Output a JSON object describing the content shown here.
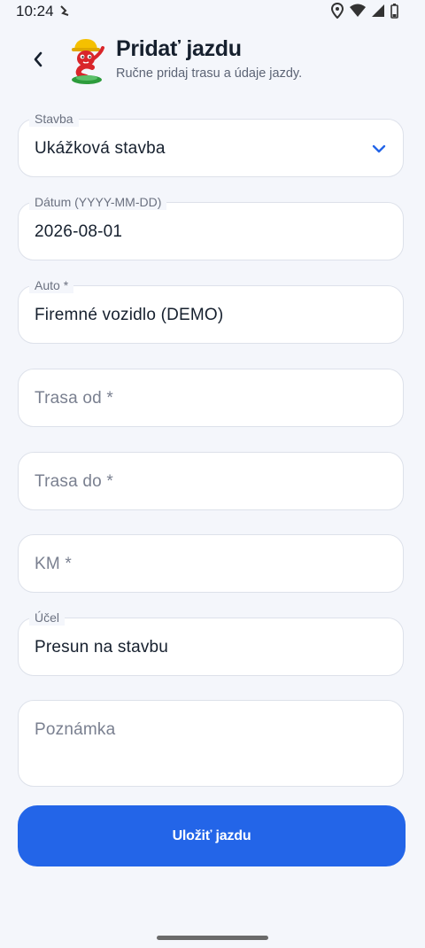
{
  "status_bar": {
    "time": "10:24"
  },
  "header": {
    "title": "Pridať jazdu",
    "subtitle": "Ručne pridaj trasu a údaje jazdy."
  },
  "form": {
    "stavba": {
      "label": "Stavba",
      "value": "Ukážková stavba"
    },
    "datum": {
      "label": "Dátum (YYYY-MM-DD)",
      "value": "2026-08-01"
    },
    "auto": {
      "label": "Auto *",
      "value": "Firemné vozidlo (DEMO)"
    },
    "trasa_od": {
      "placeholder": "Trasa od *"
    },
    "trasa_do": {
      "placeholder": "Trasa do *"
    },
    "km": {
      "placeholder": "KM *"
    },
    "ucel": {
      "label": "Účel",
      "value": "Presun na stavbu"
    },
    "poznamka": {
      "placeholder": "Poznámka"
    }
  },
  "save_button": {
    "label": "Uložiť jazdu"
  },
  "colors": {
    "accent": "#2365e8",
    "background": "#f4f6fb",
    "field_border": "#dde1ea"
  },
  "icons": [
    "vibrate-icon",
    "location-icon",
    "wifi-icon",
    "signal-icon",
    "battery-icon",
    "back-chevron-icon",
    "mascot-logo",
    "chevron-down-icon"
  ]
}
